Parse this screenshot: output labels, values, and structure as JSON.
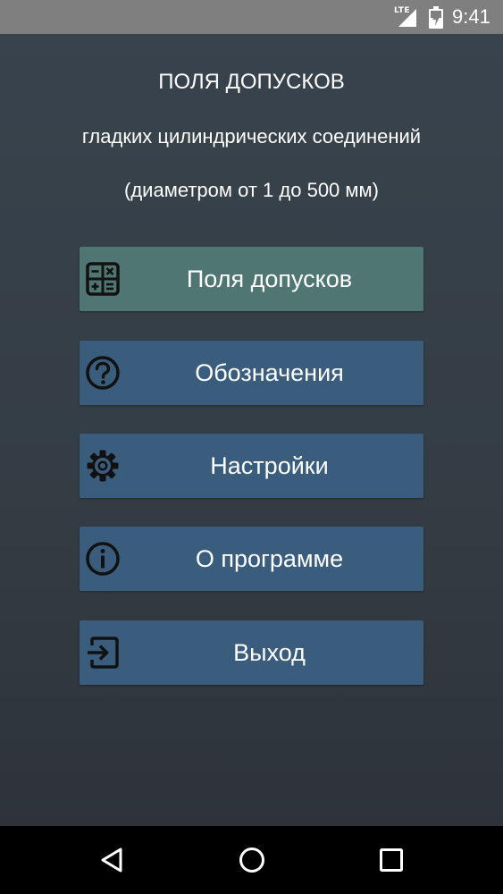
{
  "status_bar": {
    "network": "LTE",
    "time": "9:41"
  },
  "header": {
    "title": "ПОЛЯ ДОПУСКОВ",
    "subtitle": "гладких цилиндрических соединений",
    "range": "(диаметром от 1 до 500 мм)"
  },
  "menu": {
    "items": [
      {
        "label": "Поля допусков",
        "icon": "calculator-icon"
      },
      {
        "label": "Обозначения",
        "icon": "help-circle-icon"
      },
      {
        "label": "Настройки",
        "icon": "gear-icon"
      },
      {
        "label": "О программе",
        "icon": "info-icon"
      },
      {
        "label": "Выход",
        "icon": "exit-icon"
      }
    ],
    "active_index": 0
  },
  "colors": {
    "background": "#343d45",
    "button": "#3b5d7d",
    "button_active": "#4f7673",
    "icon": "#111111",
    "text": "#ffffff"
  },
  "nav_bar": {
    "buttons": [
      "back-icon",
      "home-icon",
      "recents-icon"
    ]
  }
}
